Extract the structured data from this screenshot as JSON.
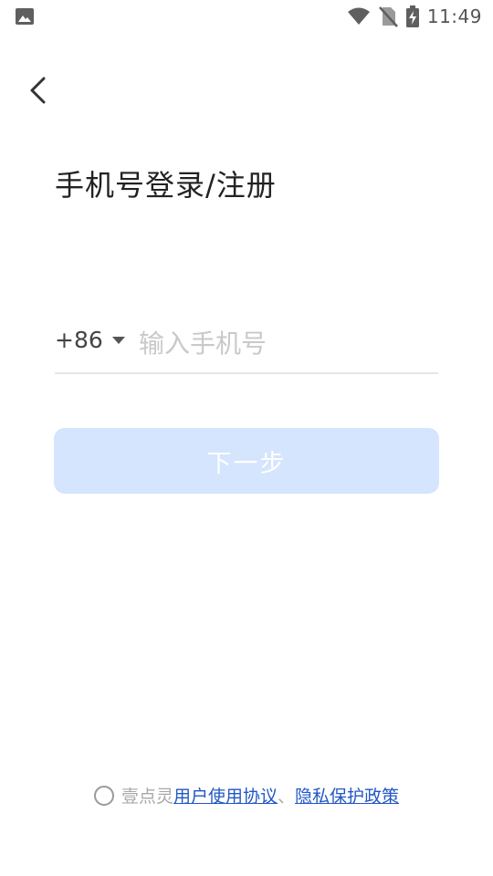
{
  "status_bar": {
    "time": "11:49",
    "icons": [
      "image-icon",
      "wifi-icon",
      "no-sim-icon",
      "battery-charging-icon"
    ]
  },
  "header": {
    "back_icon": "chevron-left-icon"
  },
  "title": "手机号登录/注册",
  "phone": {
    "country_code": "+86",
    "placeholder": "输入手机号",
    "value": ""
  },
  "next_button": {
    "label": "下一步",
    "background": "#d4e5fd"
  },
  "agreement": {
    "prefix": "壹点灵",
    "user_agreement": "用户使用协议",
    "separator": "、",
    "privacy_policy": "隐私保护政策",
    "link_color": "#2357c6"
  }
}
